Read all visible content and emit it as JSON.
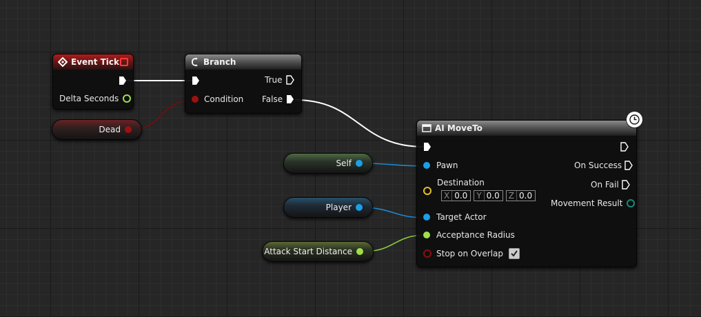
{
  "event_tick": {
    "title": "Event Tick",
    "pins": {
      "delta_seconds": "Delta Seconds"
    }
  },
  "branch": {
    "title": "Branch",
    "pins": {
      "condition": "Condition",
      "true": "True",
      "false": "False"
    }
  },
  "ai_moveto": {
    "title": "AI MoveTo",
    "inputs": {
      "pawn": "Pawn",
      "destination": "Destination",
      "target_actor": "Target Actor",
      "acceptance_radius": "Acceptance Radius",
      "stop_on_overlap": "Stop on Overlap"
    },
    "outputs": {
      "on_success": "On Success",
      "on_fail": "On Fail",
      "movement_result": "Movement Result"
    },
    "destination_vector": {
      "x_label": "X",
      "x_value": "0.0",
      "y_label": "Y",
      "y_value": "0.0",
      "z_label": "Z",
      "z_value": "0.0"
    },
    "stop_on_overlap_checked": true
  },
  "variables": {
    "dead": "Dead",
    "self": "Self",
    "player": "Player",
    "attack_start_distance": "Attack Start Distance"
  },
  "colors": {
    "boolean_pin": "#a01010",
    "object_pin": "#1aa0e8",
    "float_pin": "#9fe04a",
    "vector_pin": "#e8c020",
    "enum_pin": "#1a8a78",
    "exec_wire": "#ffffff",
    "event_header": "#b01c1c",
    "function_header": "#8c8c8c"
  }
}
